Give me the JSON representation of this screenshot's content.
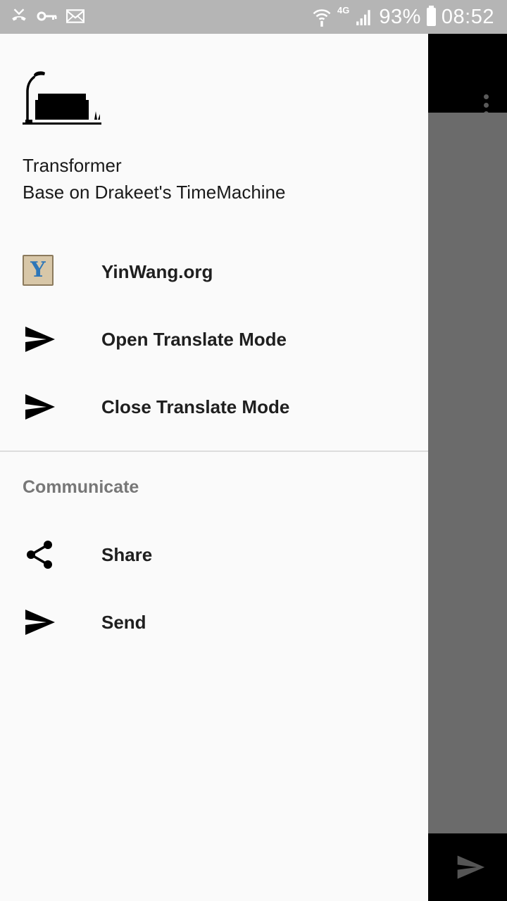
{
  "status_bar": {
    "battery_percent": "93%",
    "time": "08:52",
    "network_type": "4G",
    "left_icons": [
      "missed-call-icon",
      "vpn-key-icon",
      "mail-icon"
    ],
    "right_icons": [
      "wifi-icon",
      "signal-icon",
      "battery-icon"
    ],
    "background_color": "#b5b5b5"
  },
  "drawer": {
    "header": {
      "logo": "desk-lamp-logo",
      "title": "Transformer",
      "subtitle": "Base on Drakeet's TimeMachine"
    },
    "items": [
      {
        "label": "YinWang.org",
        "icon": "yinwang-favicon-icon"
      },
      {
        "label": "Open Translate Mode",
        "icon": "send-icon"
      },
      {
        "label": "Close Translate Mode",
        "icon": "send-icon"
      }
    ],
    "section": {
      "title": "Communicate",
      "items": [
        {
          "label": "Share",
          "icon": "share-icon"
        },
        {
          "label": "Send",
          "icon": "send-icon"
        }
      ]
    },
    "background_color": "#fafafa"
  },
  "background_app": {
    "toolbar_color": "#000000",
    "scrim_color": "#6b6b6b",
    "icons": [
      "overflow-menu-icon",
      "send-fab-icon"
    ]
  }
}
